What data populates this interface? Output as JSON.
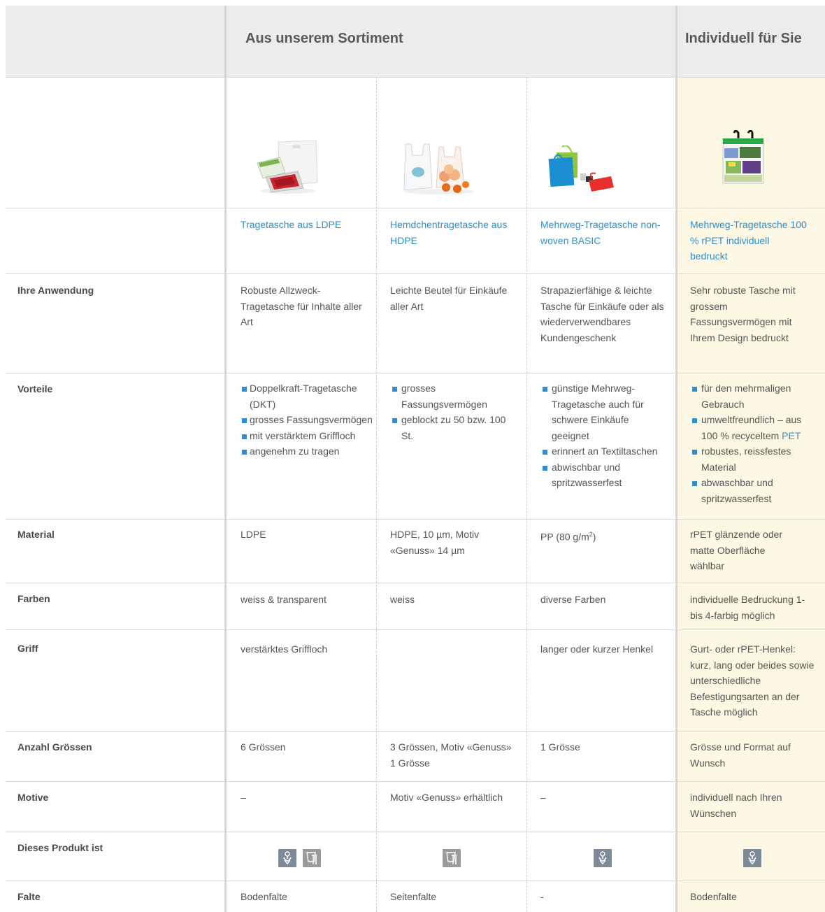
{
  "header": {
    "sortiment_title": "Aus unserem Sortiment",
    "individuell_title": "Individuell für Sie"
  },
  "products": [
    {
      "name": "Tragetasche aus LDPE",
      "image": "ldpe-bag-image"
    },
    {
      "name": "Hemdchentragetasche aus HDPE",
      "image": "hdpe-shirt-bag-image"
    },
    {
      "name": "Mehrweg-Tragetasche non-woven BASIC",
      "image": "nonwoven-bag-image"
    },
    {
      "name": "Mehrweg-Tragetasche 100 % rPET individuell bedruckt",
      "image": "rpet-printed-bag-image"
    }
  ],
  "rows": {
    "anwendung": {
      "label": "Ihre Anwendung",
      "values": [
        "Robuste Allzweck-Tragetasche für Inhalte aller Art",
        "Leichte Beutel für Einkäufe aller Art",
        "Strapazierfähige & leichte Tasche für Einkäufe oder als wiederverwendbares Kundengeschenk",
        "Sehr robuste Tasche mit grossem Fassungsvermögen mit Ihrem Design bedruckt"
      ]
    },
    "vorteile": {
      "label": "Vorteile",
      "values": [
        [
          "Doppelkraft-Tragetasche (DKT)",
          "grosses Fassungsvermögen",
          "mit verstärktem Griffloch",
          "angenehm zu tragen"
        ],
        [
          "grosses Fassungsvermögen",
          "geblockt zu 50 bzw. 100 St."
        ],
        [
          "günstige Mehrweg-Tragetasche auch für schwere Einkäufe geeignet",
          "erinnert an Textiltaschen",
          "abwischbar und spritzwasserfest"
        ],
        [
          "für den mehrmaligen Gebrauch",
          "umweltfreundlich – aus 100 % recyceltem",
          "robustes, reissfestes Material",
          "abwaschbar und spritzwasserfest"
        ]
      ],
      "pet_link": "PET"
    },
    "material": {
      "label": "Material",
      "values": [
        "LDPE",
        "HDPE, 10 µm, Motiv «Genuss» 14 µm",
        "PP (80 g/m",
        "rPET glänzende oder matte Oberfläche wählbar"
      ],
      "superscript": "2",
      "closing": ")"
    },
    "farben": {
      "label": "Farben",
      "values": [
        "weiss & transparent",
        "weiss",
        "diverse Farben",
        "individuelle Bedruckung 1- bis 4-farbig möglich"
      ]
    },
    "griff": {
      "label": "Griff",
      "values": [
        "verstärktes Griffloch",
        "",
        "langer oder kurzer Henkel",
        "Gurt- oder rPET-Henkel: kurz, lang oder beides sowie unterschiedliche Befestigungsarten an der Tasche möglich"
      ]
    },
    "groessen": {
      "label": "Anzahl Grössen",
      "values": [
        "6 Grössen",
        "3 Grössen, Motiv «Genuss» 1 Grösse",
        "1 Grösse",
        "Grösse und Format auf Wunsch"
      ]
    },
    "motive": {
      "label": "Motive",
      "values": [
        "–",
        "Motiv «Genuss» erhältlich",
        "–",
        "individuell nach Ihren Wünschen"
      ]
    },
    "produkt": {
      "label": "Dieses Produkt ist",
      "badges": [
        [
          "recyclable-icon",
          "food-safe-icon"
        ],
        [
          "food-safe-icon"
        ],
        [
          "recyclable-icon"
        ],
        [
          "recyclable-icon"
        ]
      ]
    },
    "falte": {
      "label": "Falte",
      "values": [
        "Bodenfalte",
        "Seitenfalte",
        "-",
        "Bodenfalte"
      ]
    }
  },
  "colors": {
    "link": "#2f8fce",
    "header_bg": "#ececec",
    "highlight_bg": "#fdf8e3",
    "badge_recycle": "#7d8b98",
    "badge_food": "#9a9a9a"
  }
}
